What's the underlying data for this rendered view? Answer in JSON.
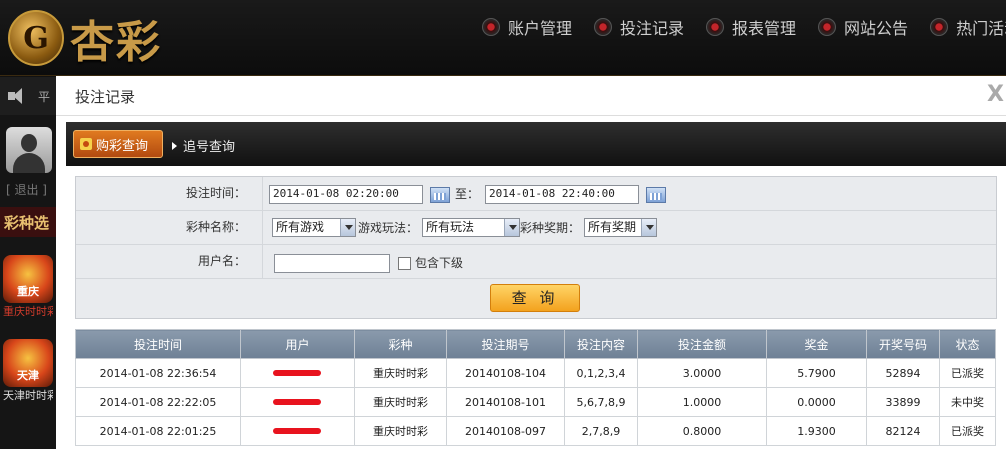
{
  "brand": {
    "name": "杏彩",
    "emblem": "G"
  },
  "topnav": [
    {
      "label": "账户管理"
    },
    {
      "label": "投注记录"
    },
    {
      "label": "报表管理"
    },
    {
      "label": "网站公告"
    },
    {
      "label": "热门活动"
    }
  ],
  "sidebar": {
    "speaker_text": "平",
    "logout": "[ 退出 ]",
    "category_title": "彩种选",
    "games": [
      {
        "label": "重庆",
        "sub": "重庆时时彩"
      },
      {
        "label": "天津",
        "sub": "天津时时彩"
      }
    ]
  },
  "modal": {
    "title": "投注记录",
    "close": "X",
    "tabs": [
      {
        "label": "购彩查询",
        "active": true
      },
      {
        "label": "追号查询",
        "active": false
      }
    ]
  },
  "filter": {
    "time_label": "投注时间：",
    "time_start": "2014-01-08 02:20:00",
    "to_label": "至：",
    "time_end": "2014-01-08 22:40:00",
    "lottery_label": "彩种名称：",
    "lottery_value": "所有游戏",
    "play_label": "游戏玩法：",
    "play_value": "所有玩法",
    "issue_label": "彩种奖期：",
    "issue_value": "所有奖期",
    "user_label": "用户名：",
    "user_value": "",
    "include_sub_label": "包含下级",
    "search_button": "查 询"
  },
  "table": {
    "headers": [
      "投注时间",
      "用户",
      "彩种",
      "投注期号",
      "投注内容",
      "投注金额",
      "奖金",
      "开奖号码",
      "状态"
    ],
    "rows": [
      {
        "time": "2014-01-08 22:36:54",
        "lottery": "重庆时时彩",
        "issue": "20140108-104",
        "content": "0,1,2,3,4",
        "amount": "3.0000",
        "prize": "5.7900",
        "draw": "52894",
        "status": "已派奖"
      },
      {
        "time": "2014-01-08 22:22:05",
        "lottery": "重庆时时彩",
        "issue": "20140108-101",
        "content": "5,6,7,8,9",
        "amount": "1.0000",
        "prize": "0.0000",
        "draw": "33899",
        "status": "未中奖"
      },
      {
        "time": "2014-01-08 22:01:25",
        "lottery": "重庆时时彩",
        "issue": "20140108-097",
        "content": "2,7,8,9",
        "amount": "0.8000",
        "prize": "1.9300",
        "draw": "82124",
        "status": "已派奖"
      }
    ]
  },
  "colors": {
    "accent_orange": "#e07a20",
    "status_green": "#2d8c1c",
    "header_bg": "#111111"
  }
}
